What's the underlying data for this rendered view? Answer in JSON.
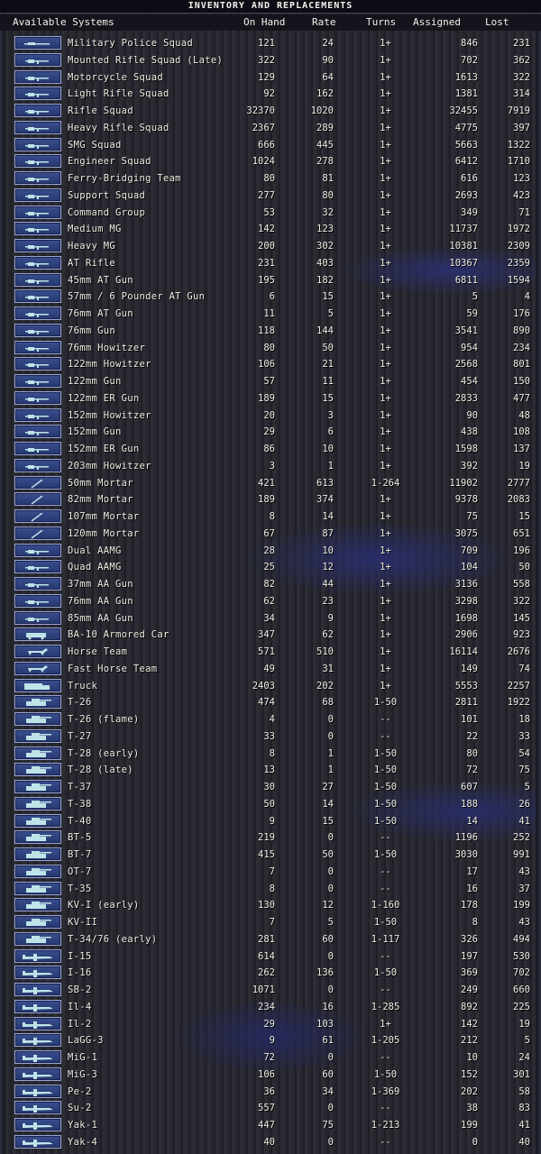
{
  "title": "INVENTORY AND REPLACEMENTS",
  "header": {
    "systems": "Available Systems",
    "onhand": "On Hand",
    "rate": "Rate",
    "turns": "Turns",
    "assigned": "Assigned",
    "lost": "Lost"
  },
  "rows": [
    {
      "name": "Military Police Squad",
      "onhand": "121",
      "rate": "24",
      "turns": "1+",
      "assigned": "846",
      "lost": "231",
      "icon": "soldier-icon"
    },
    {
      "name": "Mounted Rifle Squad (Late)",
      "onhand": "322",
      "rate": "90",
      "turns": "1+",
      "assigned": "702",
      "lost": "362",
      "icon": "cavalry-icon"
    },
    {
      "name": "Motorcycle Squad",
      "onhand": "129",
      "rate": "64",
      "turns": "1+",
      "assigned": "1613",
      "lost": "322",
      "icon": "motorcycle-icon"
    },
    {
      "name": "Light Rifle Squad",
      "onhand": "92",
      "rate": "162",
      "turns": "1+",
      "assigned": "1381",
      "lost": "314",
      "icon": "rifle-icon"
    },
    {
      "name": "Rifle Squad",
      "onhand": "32370",
      "rate": "1020",
      "turns": "1+",
      "assigned": "32455",
      "lost": "7919",
      "icon": "rifle-icon"
    },
    {
      "name": "Heavy Rifle Squad",
      "onhand": "2367",
      "rate": "289",
      "turns": "1+",
      "assigned": "4775",
      "lost": "397",
      "icon": "rifle-icon"
    },
    {
      "name": "SMG Squad",
      "onhand": "666",
      "rate": "445",
      "turns": "1+",
      "assigned": "5663",
      "lost": "1322",
      "icon": "smg-icon"
    },
    {
      "name": "Engineer Squad",
      "onhand": "1024",
      "rate": "278",
      "turns": "1+",
      "assigned": "6412",
      "lost": "1710",
      "icon": "engineer-icon"
    },
    {
      "name": "Ferry-Bridging Team",
      "onhand": "80",
      "rate": "81",
      "turns": "1+",
      "assigned": "616",
      "lost": "123",
      "icon": "bridge-icon"
    },
    {
      "name": "Support Squad",
      "onhand": "277",
      "rate": "80",
      "turns": "1+",
      "assigned": "2693",
      "lost": "423",
      "icon": "support-icon"
    },
    {
      "name": "Command Group",
      "onhand": "53",
      "rate": "32",
      "turns": "1+",
      "assigned": "349",
      "lost": "71",
      "icon": "command-icon"
    },
    {
      "name": "Medium MG",
      "onhand": "142",
      "rate": "123",
      "turns": "1+",
      "assigned": "11737",
      "lost": "1972",
      "icon": "machinegun-icon"
    },
    {
      "name": "Heavy MG",
      "onhand": "200",
      "rate": "302",
      "turns": "1+",
      "assigned": "10381",
      "lost": "2309",
      "icon": "machinegun-icon"
    },
    {
      "name": "AT Rifle",
      "onhand": "231",
      "rate": "403",
      "turns": "1+",
      "assigned": "10367",
      "lost": "2359",
      "icon": "at-rifle-icon"
    },
    {
      "name": "45mm AT Gun",
      "onhand": "195",
      "rate": "182",
      "turns": "1+",
      "assigned": "6811",
      "lost": "1594",
      "icon": "at-gun-icon"
    },
    {
      "name": "57mm / 6 Pounder AT Gun",
      "onhand": "6",
      "rate": "15",
      "turns": "1+",
      "assigned": "5",
      "lost": "4",
      "icon": "at-gun-icon"
    },
    {
      "name": "76mm AT Gun",
      "onhand": "11",
      "rate": "5",
      "turns": "1+",
      "assigned": "59",
      "lost": "176",
      "icon": "at-gun-icon"
    },
    {
      "name": "76mm Gun",
      "onhand": "118",
      "rate": "144",
      "turns": "1+",
      "assigned": "3541",
      "lost": "890",
      "icon": "field-gun-icon"
    },
    {
      "name": "76mm Howitzer",
      "onhand": "80",
      "rate": "50",
      "turns": "1+",
      "assigned": "954",
      "lost": "234",
      "icon": "howitzer-icon"
    },
    {
      "name": "122mm Howitzer",
      "onhand": "106",
      "rate": "21",
      "turns": "1+",
      "assigned": "2568",
      "lost": "801",
      "icon": "howitzer-icon"
    },
    {
      "name": "122mm Gun",
      "onhand": "57",
      "rate": "11",
      "turns": "1+",
      "assigned": "454",
      "lost": "150",
      "icon": "field-gun-icon"
    },
    {
      "name": "122mm ER Gun",
      "onhand": "189",
      "rate": "15",
      "turns": "1+",
      "assigned": "2833",
      "lost": "477",
      "icon": "field-gun-icon"
    },
    {
      "name": "152mm Howitzer",
      "onhand": "20",
      "rate": "3",
      "turns": "1+",
      "assigned": "90",
      "lost": "48",
      "icon": "howitzer-icon"
    },
    {
      "name": "152mm Gun",
      "onhand": "29",
      "rate": "6",
      "turns": "1+",
      "assigned": "438",
      "lost": "108",
      "icon": "field-gun-icon"
    },
    {
      "name": "152mm ER Gun",
      "onhand": "86",
      "rate": "10",
      "turns": "1+",
      "assigned": "1598",
      "lost": "137",
      "icon": "field-gun-icon"
    },
    {
      "name": "203mm Howitzer",
      "onhand": "3",
      "rate": "1",
      "turns": "1+",
      "assigned": "392",
      "lost": "19",
      "icon": "howitzer-icon"
    },
    {
      "name": "50mm Mortar",
      "onhand": "421",
      "rate": "613",
      "turns": "1-264",
      "assigned": "11902",
      "lost": "2777",
      "icon": "mortar-icon"
    },
    {
      "name": "82mm Mortar",
      "onhand": "189",
      "rate": "374",
      "turns": "1+",
      "assigned": "9378",
      "lost": "2083",
      "icon": "mortar-icon"
    },
    {
      "name": "107mm Mortar",
      "onhand": "8",
      "rate": "14",
      "turns": "1+",
      "assigned": "75",
      "lost": "15",
      "icon": "mortar-icon"
    },
    {
      "name": "120mm Mortar",
      "onhand": "67",
      "rate": "87",
      "turns": "1+",
      "assigned": "3075",
      "lost": "651",
      "icon": "mortar-icon"
    },
    {
      "name": "Dual AAMG",
      "onhand": "28",
      "rate": "10",
      "turns": "1+",
      "assigned": "709",
      "lost": "196",
      "icon": "aa-mg-icon"
    },
    {
      "name": "Quad AAMG",
      "onhand": "25",
      "rate": "12",
      "turns": "1+",
      "assigned": "104",
      "lost": "50",
      "icon": "aa-mg-icon"
    },
    {
      "name": "37mm AA Gun",
      "onhand": "82",
      "rate": "44",
      "turns": "1+",
      "assigned": "3136",
      "lost": "558",
      "icon": "aa-gun-icon"
    },
    {
      "name": "76mm AA Gun",
      "onhand": "62",
      "rate": "23",
      "turns": "1+",
      "assigned": "3298",
      "lost": "322",
      "icon": "aa-gun-icon"
    },
    {
      "name": "85mm AA Gun",
      "onhand": "34",
      "rate": "9",
      "turns": "1+",
      "assigned": "1698",
      "lost": "145",
      "icon": "aa-gun-icon"
    },
    {
      "name": "BA-10 Armored Car",
      "onhand": "347",
      "rate": "62",
      "turns": "1+",
      "assigned": "2906",
      "lost": "923",
      "icon": "armored-car-icon"
    },
    {
      "name": "Horse Team",
      "onhand": "571",
      "rate": "510",
      "turns": "1+",
      "assigned": "16114",
      "lost": "2676",
      "icon": "horse-icon"
    },
    {
      "name": "Fast Horse Team",
      "onhand": "49",
      "rate": "31",
      "turns": "1+",
      "assigned": "149",
      "lost": "74",
      "icon": "horse-icon"
    },
    {
      "name": "Truck",
      "onhand": "2403",
      "rate": "202",
      "turns": "1+",
      "assigned": "5553",
      "lost": "2257",
      "icon": "truck-icon"
    },
    {
      "name": "T-26",
      "onhand": "474",
      "rate": "68",
      "turns": "1-50",
      "assigned": "2811",
      "lost": "1922",
      "icon": "tank-icon"
    },
    {
      "name": "T-26 (flame)",
      "onhand": "4",
      "rate": "0",
      "turns": "--",
      "assigned": "101",
      "lost": "18",
      "icon": "tank-icon"
    },
    {
      "name": "T-27",
      "onhand": "33",
      "rate": "0",
      "turns": "--",
      "assigned": "22",
      "lost": "33",
      "icon": "tank-icon"
    },
    {
      "name": "T-28 (early)",
      "onhand": "8",
      "rate": "1",
      "turns": "1-50",
      "assigned": "80",
      "lost": "54",
      "icon": "tank-icon"
    },
    {
      "name": "T-28 (late)",
      "onhand": "13",
      "rate": "1",
      "turns": "1-50",
      "assigned": "72",
      "lost": "75",
      "icon": "tank-icon"
    },
    {
      "name": "T-37",
      "onhand": "30",
      "rate": "27",
      "turns": "1-50",
      "assigned": "607",
      "lost": "5",
      "icon": "tank-icon"
    },
    {
      "name": "T-38",
      "onhand": "50",
      "rate": "14",
      "turns": "1-50",
      "assigned": "188",
      "lost": "26",
      "icon": "tank-icon"
    },
    {
      "name": "T-40",
      "onhand": "9",
      "rate": "15",
      "turns": "1-50",
      "assigned": "14",
      "lost": "41",
      "icon": "tank-icon"
    },
    {
      "name": "BT-5",
      "onhand": "219",
      "rate": "0",
      "turns": "--",
      "assigned": "1196",
      "lost": "252",
      "icon": "tank-icon"
    },
    {
      "name": "BT-7",
      "onhand": "415",
      "rate": "50",
      "turns": "1-50",
      "assigned": "3030",
      "lost": "991",
      "icon": "tank-icon"
    },
    {
      "name": "OT-7",
      "onhand": "7",
      "rate": "0",
      "turns": "--",
      "assigned": "17",
      "lost": "43",
      "icon": "tank-icon"
    },
    {
      "name": "T-35",
      "onhand": "8",
      "rate": "0",
      "turns": "--",
      "assigned": "16",
      "lost": "37",
      "icon": "tank-icon"
    },
    {
      "name": "KV-I (early)",
      "onhand": "130",
      "rate": "12",
      "turns": "1-160",
      "assigned": "178",
      "lost": "199",
      "icon": "tank-icon"
    },
    {
      "name": "KV-II",
      "onhand": "7",
      "rate": "5",
      "turns": "1-50",
      "assigned": "8",
      "lost": "43",
      "icon": "tank-icon"
    },
    {
      "name": "T-34/76 (early)",
      "onhand": "281",
      "rate": "60",
      "turns": "1-117",
      "assigned": "326",
      "lost": "494",
      "icon": "tank-icon"
    },
    {
      "name": "I-15",
      "onhand": "614",
      "rate": "0",
      "turns": "--",
      "assigned": "197",
      "lost": "530",
      "icon": "aircraft-icon"
    },
    {
      "name": "I-16",
      "onhand": "262",
      "rate": "136",
      "turns": "1-50",
      "assigned": "369",
      "lost": "702",
      "icon": "aircraft-icon"
    },
    {
      "name": "SB-2",
      "onhand": "1071",
      "rate": "0",
      "turns": "--",
      "assigned": "249",
      "lost": "660",
      "icon": "aircraft-icon"
    },
    {
      "name": "Il-4",
      "onhand": "234",
      "rate": "16",
      "turns": "1-285",
      "assigned": "892",
      "lost": "225",
      "icon": "aircraft-icon"
    },
    {
      "name": "Il-2",
      "onhand": "29",
      "rate": "103",
      "turns": "1+",
      "assigned": "142",
      "lost": "19",
      "icon": "aircraft-icon"
    },
    {
      "name": "LaGG-3",
      "onhand": "9",
      "rate": "61",
      "turns": "1-205",
      "assigned": "212",
      "lost": "5",
      "icon": "aircraft-icon"
    },
    {
      "name": "MiG-1",
      "onhand": "72",
      "rate": "0",
      "turns": "--",
      "assigned": "10",
      "lost": "24",
      "icon": "aircraft-icon"
    },
    {
      "name": "MiG-3",
      "onhand": "106",
      "rate": "60",
      "turns": "1-50",
      "assigned": "152",
      "lost": "301",
      "icon": "aircraft-icon"
    },
    {
      "name": "Pe-2",
      "onhand": "36",
      "rate": "34",
      "turns": "1-369",
      "assigned": "202",
      "lost": "58",
      "icon": "aircraft-icon"
    },
    {
      "name": "Su-2",
      "onhand": "557",
      "rate": "0",
      "turns": "--",
      "assigned": "38",
      "lost": "83",
      "icon": "aircraft-icon"
    },
    {
      "name": "Yak-1",
      "onhand": "447",
      "rate": "75",
      "turns": "1-213",
      "assigned": "199",
      "lost": "41",
      "icon": "aircraft-icon"
    },
    {
      "name": "Yak-4",
      "onhand": "40",
      "rate": "0",
      "turns": "--",
      "assigned": "0",
      "lost": "40",
      "icon": "aircraft-icon"
    }
  ]
}
